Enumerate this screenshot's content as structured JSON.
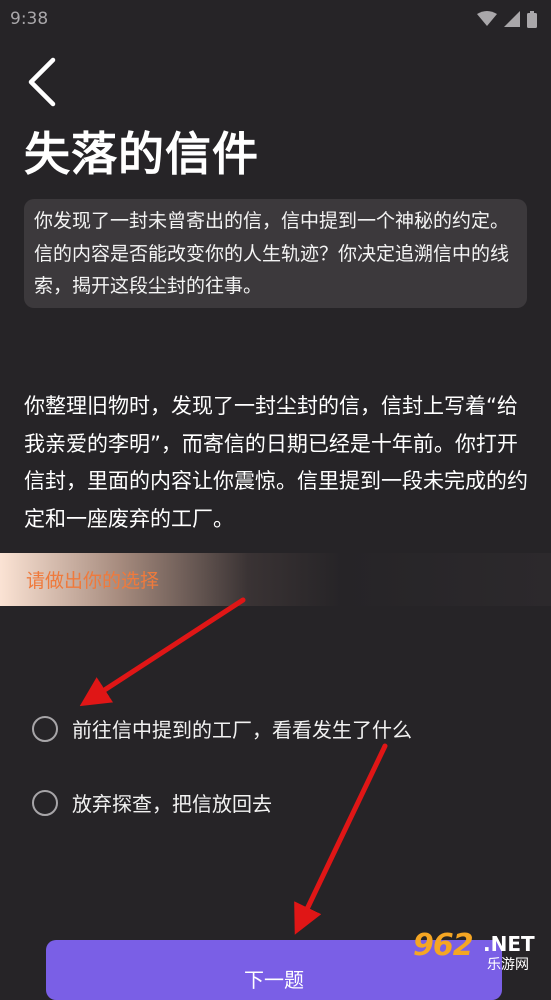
{
  "status_bar": {
    "time": "9:38"
  },
  "header": {
    "title": "失落的信件"
  },
  "intro": "你发现了一封未曾寄出的信，信中提到一个神秘的约定。信的内容是否能改变你的人生轨迹？你决定追溯信中的线索，揭开这段尘封的往事。",
  "story": "你整理旧物时，发现了一封尘封的信，信封上写着“给我亲爱的李明”，而寄信的日期已经是十年前。你打开信封，里面的内容让你震惊。信里提到一段未完成的约定和一座废弃的工厂。",
  "prompt": "请做出你的选择",
  "options": [
    {
      "label": "前往信中提到的工厂，看看发生了什么"
    },
    {
      "label": "放弃探查，把信放回去"
    }
  ],
  "next_button": {
    "label": "下一题"
  },
  "watermark": {
    "logo": "962",
    "net": ".NET",
    "sub": "乐游网"
  },
  "colors": {
    "background": "#262427",
    "accent": "#7a5fe6",
    "prompt_text": "#ef7a3c",
    "annotation_arrow": "#e01616"
  }
}
